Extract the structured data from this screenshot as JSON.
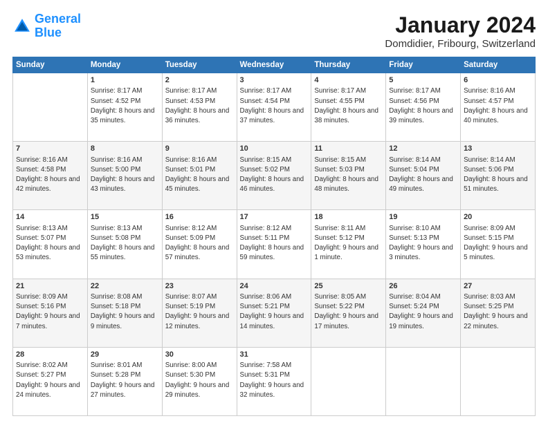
{
  "logo": {
    "line1": "General",
    "line2": "Blue"
  },
  "title": "January 2024",
  "subtitle": "Domdidier, Fribourg, Switzerland",
  "days_header": [
    "Sunday",
    "Monday",
    "Tuesday",
    "Wednesday",
    "Thursday",
    "Friday",
    "Saturday"
  ],
  "weeks": [
    [
      {
        "day": "",
        "sunrise": "",
        "sunset": "",
        "daylight": ""
      },
      {
        "day": "1",
        "sunrise": "Sunrise: 8:17 AM",
        "sunset": "Sunset: 4:52 PM",
        "daylight": "Daylight: 8 hours and 35 minutes."
      },
      {
        "day": "2",
        "sunrise": "Sunrise: 8:17 AM",
        "sunset": "Sunset: 4:53 PM",
        "daylight": "Daylight: 8 hours and 36 minutes."
      },
      {
        "day": "3",
        "sunrise": "Sunrise: 8:17 AM",
        "sunset": "Sunset: 4:54 PM",
        "daylight": "Daylight: 8 hours and 37 minutes."
      },
      {
        "day": "4",
        "sunrise": "Sunrise: 8:17 AM",
        "sunset": "Sunset: 4:55 PM",
        "daylight": "Daylight: 8 hours and 38 minutes."
      },
      {
        "day": "5",
        "sunrise": "Sunrise: 8:17 AM",
        "sunset": "Sunset: 4:56 PM",
        "daylight": "Daylight: 8 hours and 39 minutes."
      },
      {
        "day": "6",
        "sunrise": "Sunrise: 8:16 AM",
        "sunset": "Sunset: 4:57 PM",
        "daylight": "Daylight: 8 hours and 40 minutes."
      }
    ],
    [
      {
        "day": "7",
        "sunrise": "Sunrise: 8:16 AM",
        "sunset": "Sunset: 4:58 PM",
        "daylight": "Daylight: 8 hours and 42 minutes."
      },
      {
        "day": "8",
        "sunrise": "Sunrise: 8:16 AM",
        "sunset": "Sunset: 5:00 PM",
        "daylight": "Daylight: 8 hours and 43 minutes."
      },
      {
        "day": "9",
        "sunrise": "Sunrise: 8:16 AM",
        "sunset": "Sunset: 5:01 PM",
        "daylight": "Daylight: 8 hours and 45 minutes."
      },
      {
        "day": "10",
        "sunrise": "Sunrise: 8:15 AM",
        "sunset": "Sunset: 5:02 PM",
        "daylight": "Daylight: 8 hours and 46 minutes."
      },
      {
        "day": "11",
        "sunrise": "Sunrise: 8:15 AM",
        "sunset": "Sunset: 5:03 PM",
        "daylight": "Daylight: 8 hours and 48 minutes."
      },
      {
        "day": "12",
        "sunrise": "Sunrise: 8:14 AM",
        "sunset": "Sunset: 5:04 PM",
        "daylight": "Daylight: 8 hours and 49 minutes."
      },
      {
        "day": "13",
        "sunrise": "Sunrise: 8:14 AM",
        "sunset": "Sunset: 5:06 PM",
        "daylight": "Daylight: 8 hours and 51 minutes."
      }
    ],
    [
      {
        "day": "14",
        "sunrise": "Sunrise: 8:13 AM",
        "sunset": "Sunset: 5:07 PM",
        "daylight": "Daylight: 8 hours and 53 minutes."
      },
      {
        "day": "15",
        "sunrise": "Sunrise: 8:13 AM",
        "sunset": "Sunset: 5:08 PM",
        "daylight": "Daylight: 8 hours and 55 minutes."
      },
      {
        "day": "16",
        "sunrise": "Sunrise: 8:12 AM",
        "sunset": "Sunset: 5:09 PM",
        "daylight": "Daylight: 8 hours and 57 minutes."
      },
      {
        "day": "17",
        "sunrise": "Sunrise: 8:12 AM",
        "sunset": "Sunset: 5:11 PM",
        "daylight": "Daylight: 8 hours and 59 minutes."
      },
      {
        "day": "18",
        "sunrise": "Sunrise: 8:11 AM",
        "sunset": "Sunset: 5:12 PM",
        "daylight": "Daylight: 9 hours and 1 minute."
      },
      {
        "day": "19",
        "sunrise": "Sunrise: 8:10 AM",
        "sunset": "Sunset: 5:13 PM",
        "daylight": "Daylight: 9 hours and 3 minutes."
      },
      {
        "day": "20",
        "sunrise": "Sunrise: 8:09 AM",
        "sunset": "Sunset: 5:15 PM",
        "daylight": "Daylight: 9 hours and 5 minutes."
      }
    ],
    [
      {
        "day": "21",
        "sunrise": "Sunrise: 8:09 AM",
        "sunset": "Sunset: 5:16 PM",
        "daylight": "Daylight: 9 hours and 7 minutes."
      },
      {
        "day": "22",
        "sunrise": "Sunrise: 8:08 AM",
        "sunset": "Sunset: 5:18 PM",
        "daylight": "Daylight: 9 hours and 9 minutes."
      },
      {
        "day": "23",
        "sunrise": "Sunrise: 8:07 AM",
        "sunset": "Sunset: 5:19 PM",
        "daylight": "Daylight: 9 hours and 12 minutes."
      },
      {
        "day": "24",
        "sunrise": "Sunrise: 8:06 AM",
        "sunset": "Sunset: 5:21 PM",
        "daylight": "Daylight: 9 hours and 14 minutes."
      },
      {
        "day": "25",
        "sunrise": "Sunrise: 8:05 AM",
        "sunset": "Sunset: 5:22 PM",
        "daylight": "Daylight: 9 hours and 17 minutes."
      },
      {
        "day": "26",
        "sunrise": "Sunrise: 8:04 AM",
        "sunset": "Sunset: 5:24 PM",
        "daylight": "Daylight: 9 hours and 19 minutes."
      },
      {
        "day": "27",
        "sunrise": "Sunrise: 8:03 AM",
        "sunset": "Sunset: 5:25 PM",
        "daylight": "Daylight: 9 hours and 22 minutes."
      }
    ],
    [
      {
        "day": "28",
        "sunrise": "Sunrise: 8:02 AM",
        "sunset": "Sunset: 5:27 PM",
        "daylight": "Daylight: 9 hours and 24 minutes."
      },
      {
        "day": "29",
        "sunrise": "Sunrise: 8:01 AM",
        "sunset": "Sunset: 5:28 PM",
        "daylight": "Daylight: 9 hours and 27 minutes."
      },
      {
        "day": "30",
        "sunrise": "Sunrise: 8:00 AM",
        "sunset": "Sunset: 5:30 PM",
        "daylight": "Daylight: 9 hours and 29 minutes."
      },
      {
        "day": "31",
        "sunrise": "Sunrise: 7:58 AM",
        "sunset": "Sunset: 5:31 PM",
        "daylight": "Daylight: 9 hours and 32 minutes."
      },
      {
        "day": "",
        "sunrise": "",
        "sunset": "",
        "daylight": ""
      },
      {
        "day": "",
        "sunrise": "",
        "sunset": "",
        "daylight": ""
      },
      {
        "day": "",
        "sunrise": "",
        "sunset": "",
        "daylight": ""
      }
    ]
  ]
}
